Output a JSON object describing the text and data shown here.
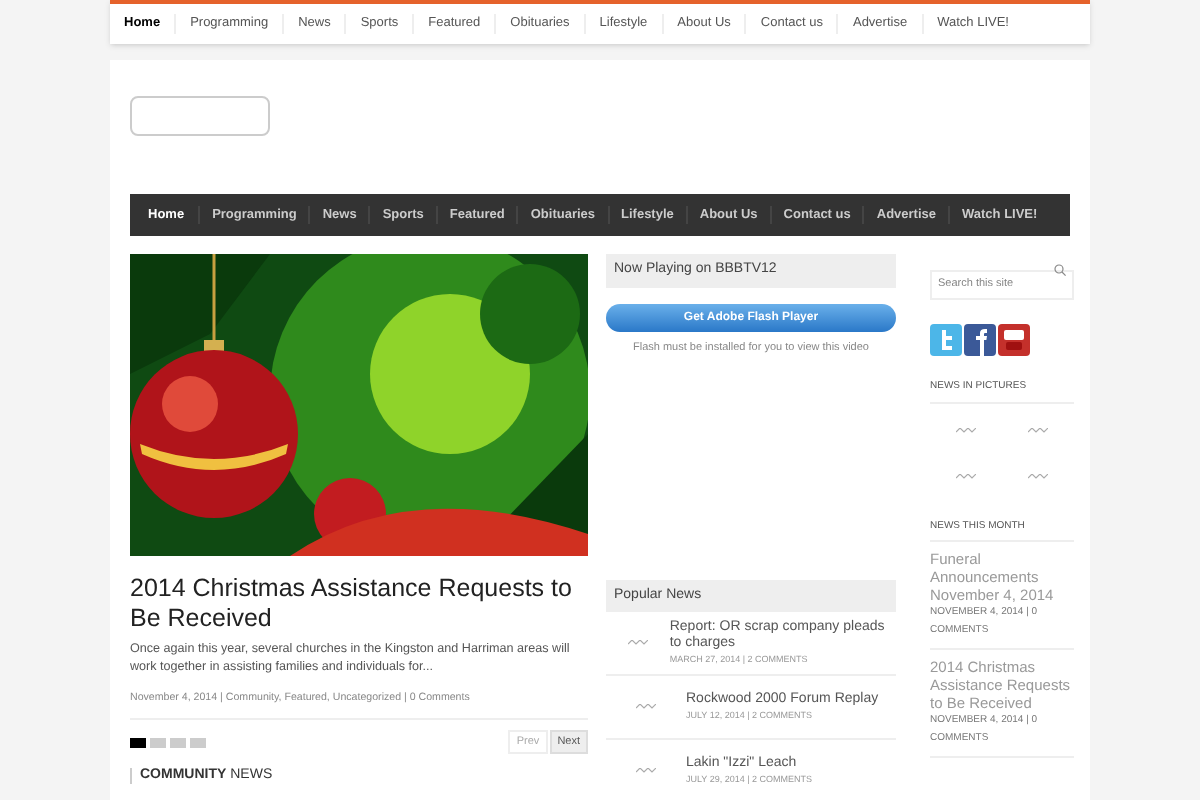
{
  "top_nav": [
    {
      "label": "Home",
      "selected": true
    },
    {
      "label": "Programming",
      "selected": false
    },
    {
      "label": "News",
      "selected": false
    },
    {
      "label": "Sports",
      "selected": false
    },
    {
      "label": "Featured",
      "selected": false
    },
    {
      "label": "Obituaries",
      "selected": false
    },
    {
      "label": "Lifestyle",
      "selected": false
    },
    {
      "label": "About Us",
      "selected": false
    },
    {
      "label": "Contact us",
      "selected": false
    },
    {
      "label": "Advertise",
      "selected": false
    },
    {
      "label": "Watch LIVE!",
      "selected": false
    }
  ],
  "main_nav": [
    {
      "label": "Home",
      "selected": true
    },
    {
      "label": "Programming",
      "selected": false
    },
    {
      "label": "News",
      "selected": false
    },
    {
      "label": "Sports",
      "selected": false
    },
    {
      "label": "Featured",
      "selected": false
    },
    {
      "label": "Obituaries",
      "selected": false
    },
    {
      "label": "Lifestyle",
      "selected": false
    },
    {
      "label": "About Us",
      "selected": false
    },
    {
      "label": "Contact us",
      "selected": false
    },
    {
      "label": "Advertise",
      "selected": false
    },
    {
      "label": "Watch LIVE!",
      "selected": false
    }
  ],
  "featured": {
    "title": "2014 Christmas Assistance Requests to Be Received",
    "excerpt": "Once again this year, several churches in the Kingston and Harriman areas will work together in assisting families and individuals for...",
    "meta": "November 4, 2014 | Community, Featured, Uncategorized | 0 Comments",
    "slides": [
      {
        "selected": true
      },
      {
        "selected": false
      },
      {
        "selected": false
      },
      {
        "selected": false
      }
    ],
    "prev": "Prev",
    "next": "Next"
  },
  "community_heading": "**COMMUNITY** NEWS",
  "now_playing": {
    "title": "Now Playing on BBBTV12",
    "button": "Get Adobe Flash Player",
    "note": "Flash must be installed for you to view this video"
  },
  "popular_news": {
    "title": "Popular News",
    "items": [
      {
        "title": "Report: OR scrap company pleads to charges",
        "meta": "MARCH 27, 2014 | 2 COMMENTS"
      },
      {
        "title": "Rockwood 2000 Forum Replay",
        "meta": "JULY 12, 2014 | 2 COMMENTS"
      },
      {
        "title": "Lakin \"Izzi\" Leach",
        "meta": "JULY 29, 2014 | 2 COMMENTS"
      }
    ]
  },
  "sidebar": {
    "search_placeholder": "Search this site",
    "social": [
      {
        "kind": "twitter"
      },
      {
        "kind": "facebook"
      },
      {
        "kind": "youtube"
      }
    ],
    "news_in_pictures": "NEWS IN PICTURES",
    "news_this_month": "NEWS THIS MONTH",
    "month_items": [
      {
        "title": "Funeral Announcements November 4, 2014",
        "meta": "NOVEMBER 4, 2014 | 0 COMMENTS"
      },
      {
        "title": "2014 Christmas Assistance Requests to Be Received",
        "meta": "NOVEMBER 4, 2014 | 0 COMMENTS"
      }
    ]
  }
}
